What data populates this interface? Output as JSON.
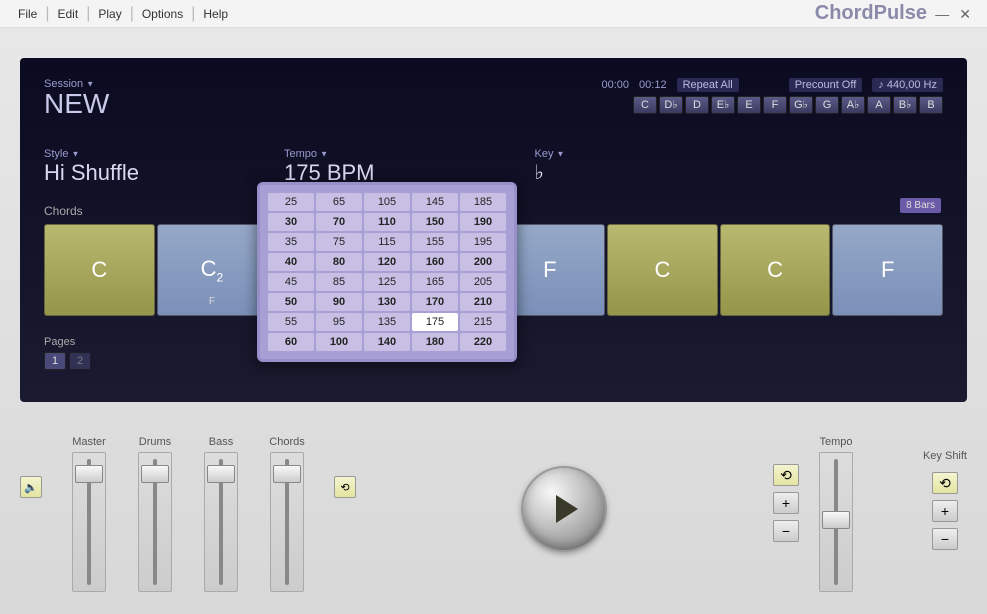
{
  "menubar": [
    "File",
    "Edit",
    "Play",
    "Options",
    "Help"
  ],
  "app_name": "ChordPulse",
  "session": {
    "label": "Session",
    "title": "NEW"
  },
  "transport": {
    "pos": "00:00",
    "len": "00:12",
    "repeat": "Repeat All",
    "precount": "Precount Off",
    "tuning": "440,00 Hz"
  },
  "key_buttons": [
    "C",
    "D♭",
    "D",
    "E♭",
    "E",
    "F",
    "G♭",
    "G",
    "A♭",
    "A",
    "B♭",
    "B"
  ],
  "style": {
    "label": "Style",
    "value": "Hi Shuffle"
  },
  "tempo": {
    "label": "Tempo",
    "value": "175 BPM"
  },
  "key": {
    "label": "Key",
    "value": "♭"
  },
  "bars": "8 Bars",
  "chords_label": "Chords",
  "chords": [
    {
      "name": "C",
      "sub": "",
      "color": "olive"
    },
    {
      "name": "C",
      "sup": "2",
      "sub": "F",
      "color": "blue"
    },
    {
      "name": "",
      "sub": "",
      "color": "blue",
      "hidden": true
    },
    {
      "name": "",
      "sub": "",
      "color": "blue",
      "hidden": true
    },
    {
      "name": "F",
      "sub": "",
      "color": "blue"
    },
    {
      "name": "C",
      "sub": "",
      "color": "olive"
    },
    {
      "name": "C",
      "sub": "",
      "color": "olive"
    },
    {
      "name": "F",
      "sub": "",
      "color": "blue"
    }
  ],
  "pages": {
    "label": "Pages",
    "items": [
      "1",
      "2"
    ],
    "active": 0
  },
  "tempo_grid": {
    "rows": [
      [
        25,
        65,
        105,
        145,
        185
      ],
      [
        30,
        70,
        110,
        150,
        190
      ],
      [
        35,
        75,
        115,
        155,
        195
      ],
      [
        40,
        80,
        120,
        160,
        200
      ],
      [
        45,
        85,
        125,
        165,
        205
      ],
      [
        50,
        90,
        130,
        170,
        210
      ],
      [
        55,
        95,
        135,
        175,
        215
      ],
      [
        60,
        100,
        140,
        180,
        220
      ]
    ],
    "bold_rows": [
      1,
      3,
      5,
      7
    ],
    "selected": 175
  },
  "faders": {
    "labels": [
      "Master",
      "Drums",
      "Bass",
      "Chords"
    ],
    "pos": [
      12,
      12,
      12,
      12
    ]
  },
  "tempo_fader": {
    "label": "Tempo",
    "pos": 58
  },
  "keyshift": {
    "label": "Key Shift"
  }
}
